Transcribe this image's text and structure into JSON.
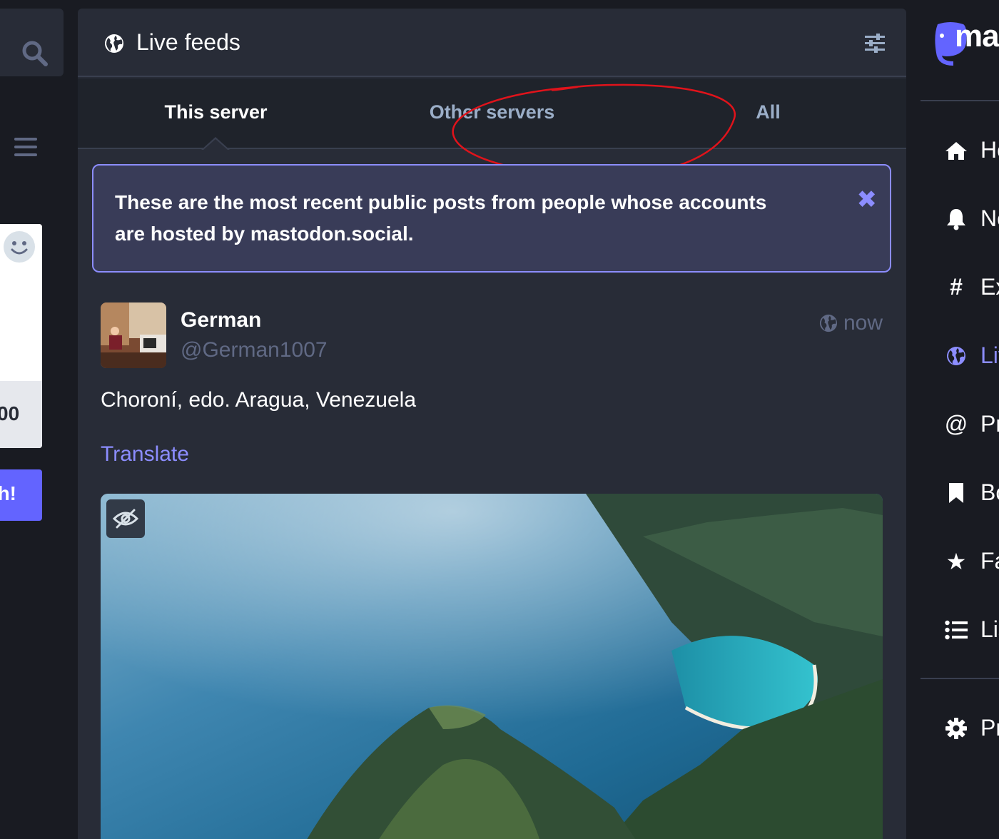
{
  "left": {
    "counter": "00",
    "publish_label": "h!"
  },
  "header": {
    "title": "Live feeds"
  },
  "tabs": [
    {
      "label": "This server",
      "active": true
    },
    {
      "label": "Other servers",
      "active": false
    },
    {
      "label": "All",
      "active": false
    }
  ],
  "info": {
    "text": "These are the most recent public posts from people whose accounts are hosted by mastodon.social.",
    "close_glyph": "✖"
  },
  "status": {
    "display_name": "German",
    "acct": "@German1007",
    "time": "now",
    "content": "Choroní, edo. Aragua, Venezuela",
    "translate_label": "Translate"
  },
  "nav": {
    "logo_text": "ma",
    "items": [
      {
        "label": "Ho",
        "icon": "home-icon"
      },
      {
        "label": "No",
        "icon": "bell-icon"
      },
      {
        "label": "Ex",
        "icon": "hashtag-icon"
      },
      {
        "label": "Liv",
        "icon": "globe-icon",
        "active": true
      },
      {
        "label": "Pr",
        "icon": "at-icon"
      },
      {
        "label": "Bo",
        "icon": "bookmark-icon"
      },
      {
        "label": "Fa",
        "icon": "star-icon"
      },
      {
        "label": "Lis",
        "icon": "list-icon"
      },
      {
        "label": "Pr",
        "icon": "gear-icon"
      }
    ]
  },
  "colors": {
    "accent": "#8c8dff",
    "annotation": "#e0131b",
    "column_bg": "#282c37",
    "page_bg": "#191b22"
  }
}
